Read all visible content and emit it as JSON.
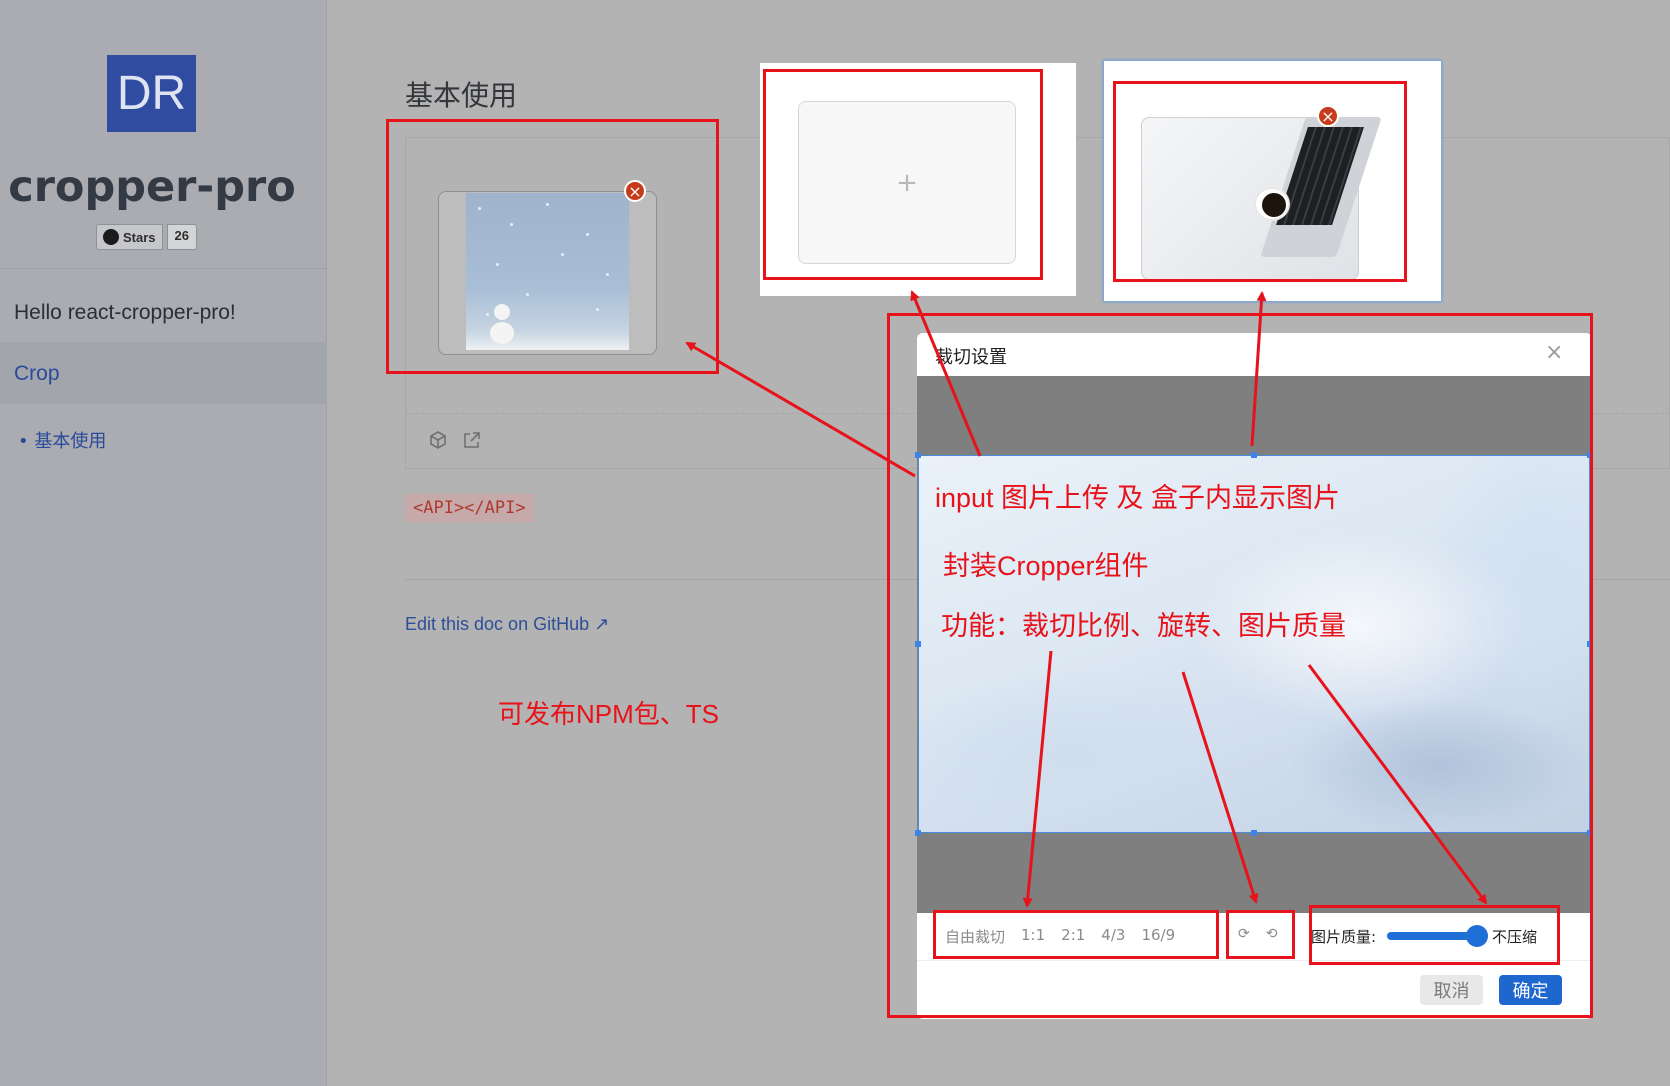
{
  "sidebar": {
    "logo_text": "DR",
    "site_title": "cropper-pro",
    "stars_label": "Stars",
    "stars_count": "26",
    "nav_hello": "Hello react-cropper-pro!",
    "nav_crop": "Crop",
    "nav_sub": "• 基本使用"
  },
  "main": {
    "page_title": "基本使用",
    "api_code": "<API></API>",
    "edit_link": "Edit this doc on GitHub ↗",
    "npm_note": "可发布NPM包、TS"
  },
  "upload": {
    "empty_plus": "+",
    "remove_icon": "×"
  },
  "modal": {
    "title": "裁切设置",
    "close": "×",
    "ratios": [
      "自由裁切",
      "1:1",
      "2:1",
      "4/3",
      "16/9"
    ],
    "rotate_cw": "⟳",
    "rotate_ccw": "⟲",
    "quality_label": "图片质量:",
    "quality_value": "不压缩",
    "quality_level": 1.0,
    "cancel_label": "取消",
    "ok_label": "确定"
  },
  "annotations": {
    "upload_note": "input 图片上传 及 盒子内显示图片",
    "component_note": "封装Cropper组件",
    "feature_note": "功能：裁切比例、旋转、图片质量",
    "annotation_color": "#e8121a"
  },
  "colors": {
    "brand": "#304ca0",
    "link": "#2c4a9a",
    "primary_button": "#1d67cf"
  }
}
